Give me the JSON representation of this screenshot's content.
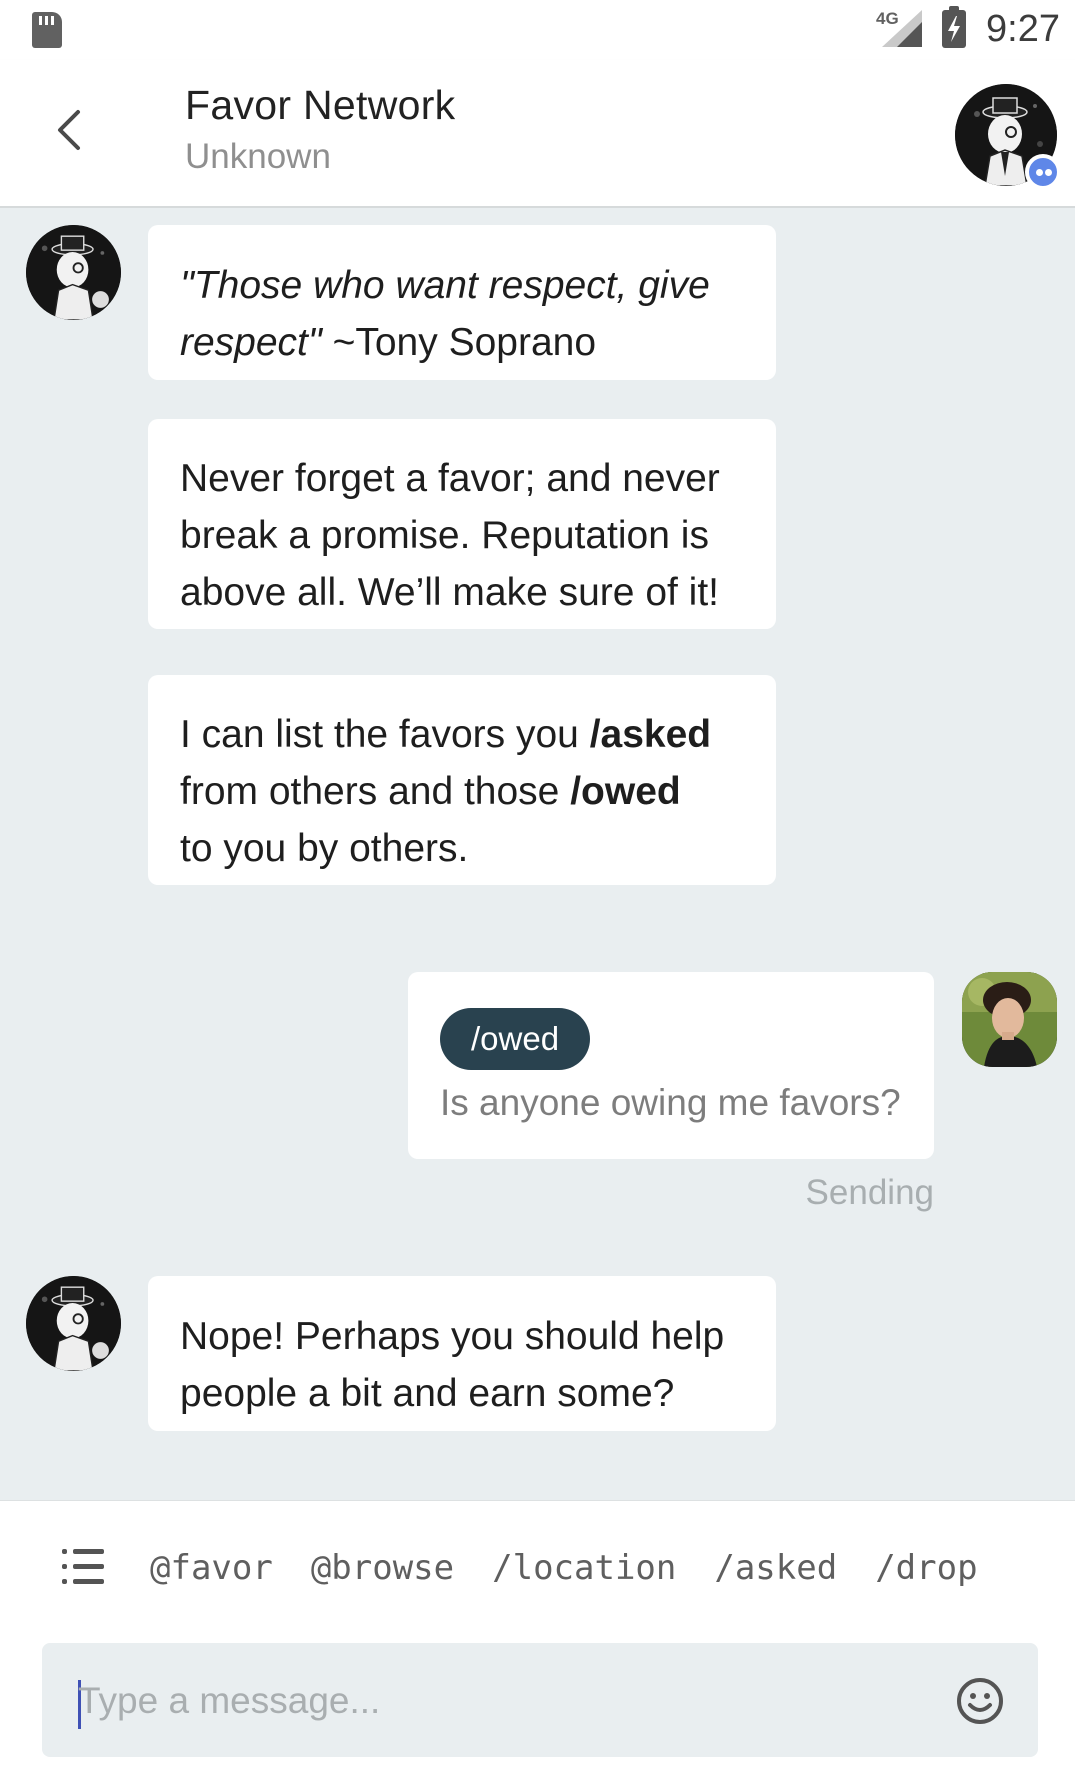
{
  "status_bar": {
    "network": "4G",
    "time": "9:27"
  },
  "header": {
    "title": "Favor Network",
    "subtitle": "Unknown"
  },
  "messages": [
    {
      "sender": "bot",
      "lines": [
        [
          {
            "text": "\"Those who want respect, give",
            "style": "italic"
          }
        ],
        [
          {
            "text": "respect\"",
            "style": "italic"
          },
          {
            "text": " ~Tony Soprano",
            "style": "normal"
          }
        ]
      ]
    },
    {
      "sender": "bot",
      "lines": [
        [
          {
            "text": "Never forget a favor; and never",
            "style": "normal"
          }
        ],
        [
          {
            "text": "break a promise. Reputation is",
            "style": "normal"
          }
        ],
        [
          {
            "text": "above all. We’ll make sure of it!",
            "style": "normal"
          }
        ]
      ]
    },
    {
      "sender": "bot",
      "lines": [
        [
          {
            "text": "I can list the favors you ",
            "style": "normal"
          },
          {
            "text": "/asked",
            "style": "bold"
          }
        ],
        [
          {
            "text": "from others and those ",
            "style": "normal"
          },
          {
            "text": "/owed",
            "style": "bold"
          }
        ],
        [
          {
            "text": "to you by others.",
            "style": "normal"
          }
        ]
      ]
    },
    {
      "sender": "user",
      "command": "/owed",
      "text": "Is anyone owing me favors?",
      "status": "Sending"
    },
    {
      "sender": "bot",
      "lines": [
        [
          {
            "text": "Nope! Perhaps you should help",
            "style": "normal"
          }
        ],
        [
          {
            "text": "people a bit and earn some?",
            "style": "normal"
          }
        ]
      ]
    }
  ],
  "composer": {
    "shortcuts": [
      "@favor",
      "@browse",
      "/location",
      "/asked",
      "/drop"
    ],
    "placeholder": "Type a message..."
  },
  "icons": {
    "back": "chevron-left-icon",
    "menu": "list-icon",
    "emoji": "smiley-icon",
    "bot_badge": "bot-badge-icon"
  },
  "colors": {
    "chat_background": "#e9eef0",
    "command_chip": "#29424f",
    "bot_badge": "#5f87e8",
    "caret": "#3f51b5"
  }
}
